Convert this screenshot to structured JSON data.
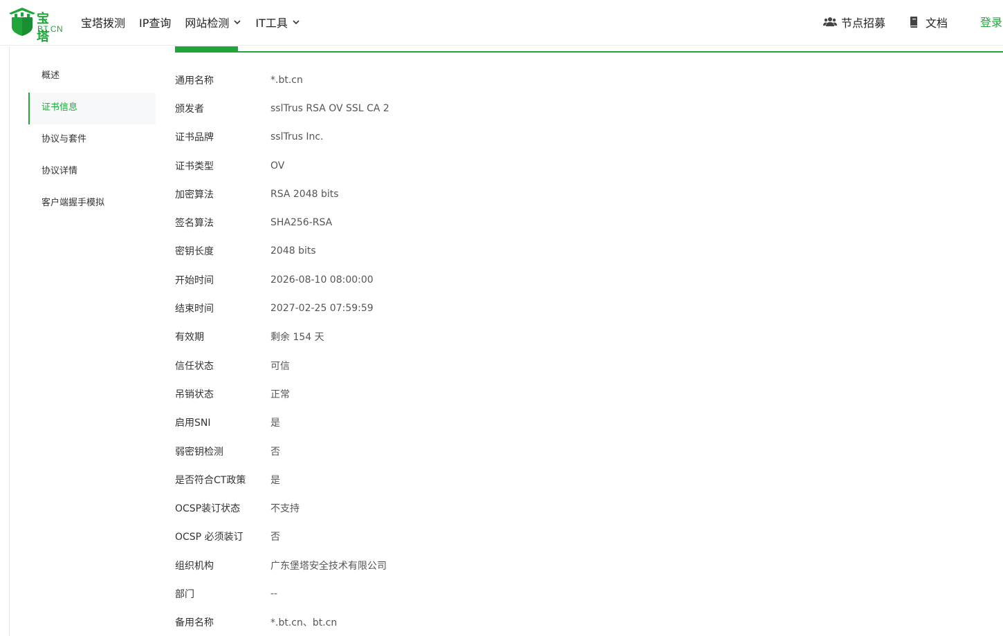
{
  "brand": {
    "name_cn": "宝塔",
    "name_en": "BT.CN",
    "color": "#20a53a"
  },
  "nav": {
    "items": [
      {
        "label": "宝塔拨测",
        "dropdown": false
      },
      {
        "label": "IP查询",
        "dropdown": false
      },
      {
        "label": "网站检测",
        "dropdown": true
      },
      {
        "label": "IT工具",
        "dropdown": true
      }
    ],
    "recruit": {
      "label": "节点招募",
      "icon": "users-icon"
    },
    "docs": {
      "label": "文档",
      "icon": "book-icon"
    },
    "login": "登录"
  },
  "sidebar": {
    "items": [
      {
        "label": "概述",
        "active": false
      },
      {
        "label": "证书信息",
        "active": true
      },
      {
        "label": "协议与套件",
        "active": false
      },
      {
        "label": "协议详情",
        "active": false
      },
      {
        "label": "客户端握手模拟",
        "active": false
      }
    ]
  },
  "cert": {
    "rows": [
      {
        "key": "通用名称",
        "value": "*.bt.cn"
      },
      {
        "key": "颁发者",
        "value": "sslTrus RSA OV SSL CA 2"
      },
      {
        "key": "证书品牌",
        "value": "sslTrus Inc."
      },
      {
        "key": "证书类型",
        "value": "OV"
      },
      {
        "key": "加密算法",
        "value": "RSA 2048 bits"
      },
      {
        "key": "签名算法",
        "value": "SHA256-RSA"
      },
      {
        "key": "密钥长度",
        "value": "2048 bits"
      },
      {
        "key": "开始时间",
        "value": "2026-08-10 08:00:00"
      },
      {
        "key": "结束时间",
        "value": "2027-02-25 07:59:59"
      },
      {
        "key": "有效期",
        "value": "剩余 154 天"
      },
      {
        "key": "信任状态",
        "value": "可信"
      },
      {
        "key": "吊销状态",
        "value": "正常"
      },
      {
        "key": "启用SNI",
        "value": "是"
      },
      {
        "key": "弱密钥检测",
        "value": "否"
      },
      {
        "key": "是否符合CT政策",
        "value": "是"
      },
      {
        "key": "OCSP装订状态",
        "value": "不支持"
      },
      {
        "key": "OCSP 必须装订",
        "value": "否"
      },
      {
        "key": "组织机构",
        "value": "广东堡塔安全技术有限公司"
      },
      {
        "key": "部门",
        "value": "--"
      },
      {
        "key": "备用名称",
        "value": "*.bt.cn、bt.cn"
      }
    ]
  }
}
